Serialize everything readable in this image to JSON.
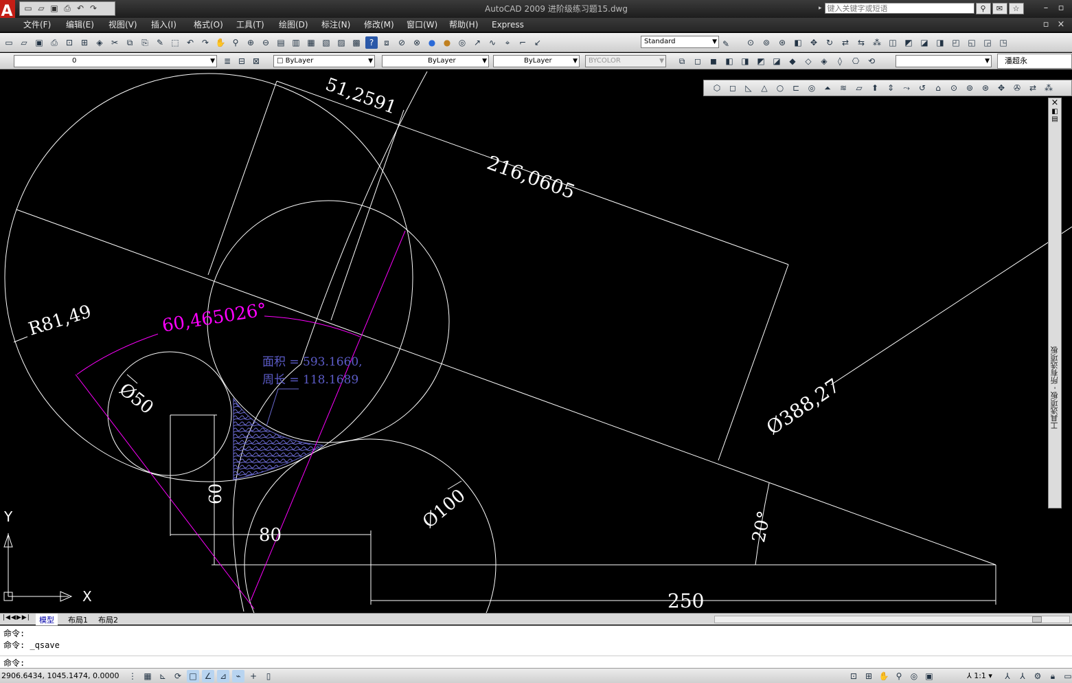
{
  "title_bar": {
    "app_title": "AutoCAD 2009",
    "file_name": "进阶级练习题15.dwg",
    "search_placeholder": "键入关键字或短语",
    "app_logo_letter": "A"
  },
  "menu": [
    {
      "label": "文件(F)"
    },
    {
      "label": "编辑(E)"
    },
    {
      "label": "视图(V)"
    },
    {
      "label": "插入(I)"
    },
    {
      "label": "格式(O)"
    },
    {
      "label": "工具(T)"
    },
    {
      "label": "绘图(D)"
    },
    {
      "label": "标注(N)"
    },
    {
      "label": "修改(M)"
    },
    {
      "label": "窗口(W)"
    },
    {
      "label": "帮助(H)"
    },
    {
      "label": "Express"
    }
  ],
  "toolbar": {
    "text_style": "Standard",
    "layer": "0",
    "color": "ByLayer",
    "linetype": "ByLayer",
    "lineweight": "ByLayer",
    "plot_style": "BYCOLOR",
    "user_field": "潘超永"
  },
  "drawing": {
    "dim_top_short": "51,2591",
    "dim_top_long": "216,0605",
    "dim_radius": "R81,49",
    "dim_angle_magenta": "60,465026°",
    "dim_phi50": "Ø50",
    "dim_phi100": "Ø100",
    "dim_phi388": "Ø388,27",
    "dim_60": "60",
    "dim_80": "80",
    "dim_250": "250",
    "dim_20deg": "20°",
    "area_label": "面积 = 593.1660,",
    "perimeter_label": "周长 = 118.1689",
    "ucs_x": "X",
    "ucs_y": "Y"
  },
  "palette": {
    "label": "工具选项板 - 所有选项板"
  },
  "tabs": [
    {
      "label": "模型"
    },
    {
      "label": "布局1"
    },
    {
      "label": "布局2"
    }
  ],
  "command_line": {
    "line1": "命令:",
    "line2": "命令: _qsave",
    "prompt": "命令:"
  },
  "status": {
    "coordinates": "2906.6434, 1045.1474, 0.0000",
    "scale": "1:1"
  },
  "colors": {
    "accent_magenta": "#ff00ff",
    "area_text": "#5c5cc8",
    "lines": "#ffffff",
    "canvas_bg": "#000000"
  }
}
